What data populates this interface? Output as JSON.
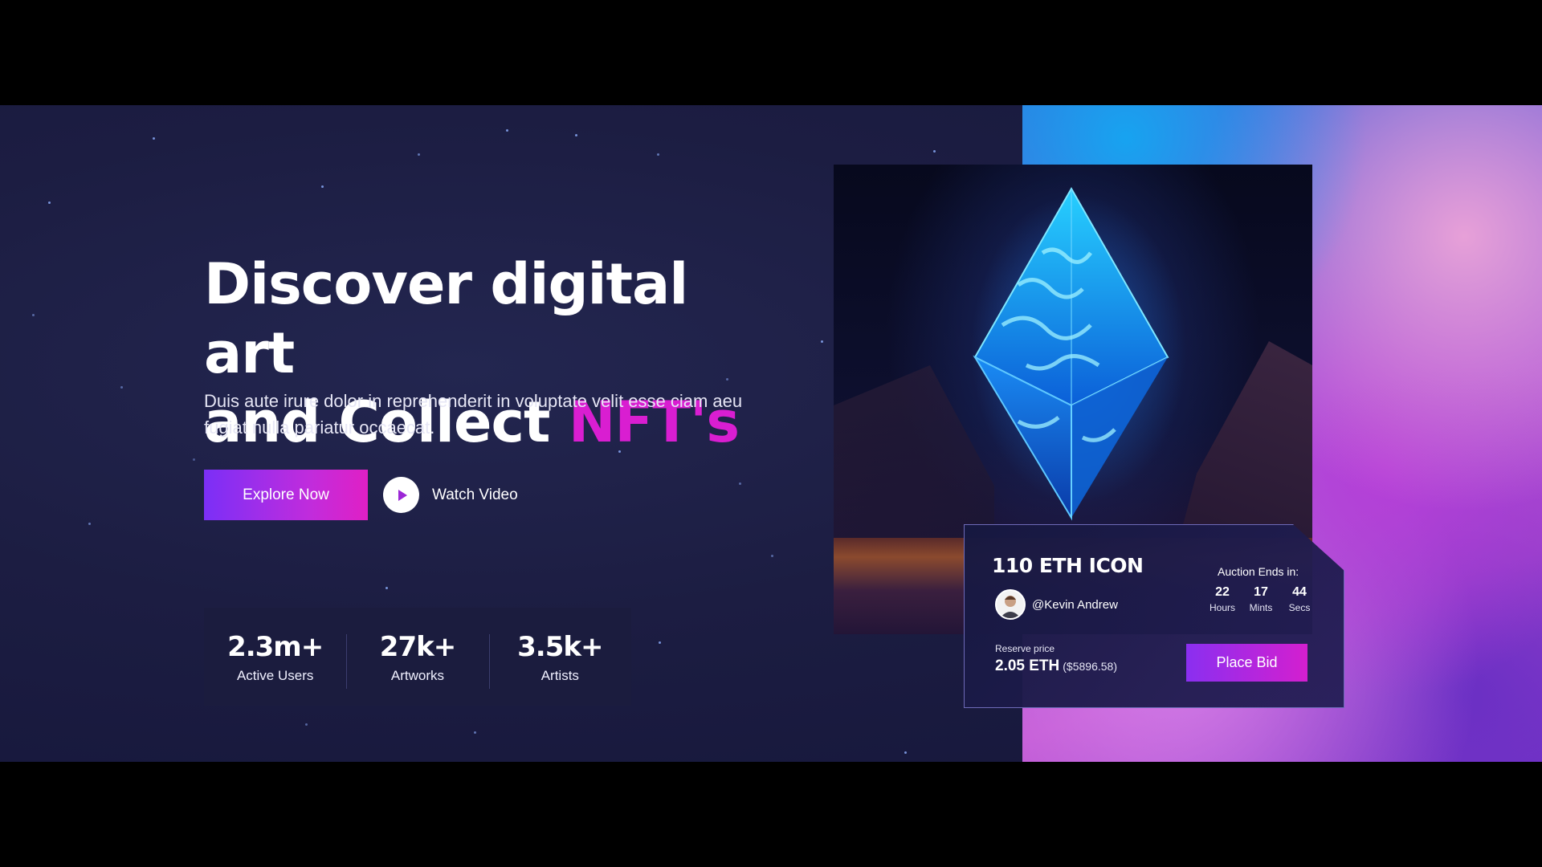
{
  "hero": {
    "headline_line1": "Discover digital art",
    "headline_line2_prefix": "and Collect ",
    "headline_line2_accent": "NFT's",
    "subtitle": "Duis aute irure dolor in reprehenderit in voluptate velit esse ciam aeu fugiat nulla pariatur occaecat.",
    "explore_label": "Explore Now",
    "watch_label": "Watch Video"
  },
  "stats": [
    {
      "value": "2.3m+",
      "label": "Active Users"
    },
    {
      "value": "27k+",
      "label": "Artworks"
    },
    {
      "value": "3.5k+",
      "label": "Artists"
    }
  ],
  "auction": {
    "title": "110 ETH ICON",
    "creator": "@Kevin Andrew",
    "ends_label": "Auction Ends in:",
    "countdown": [
      {
        "value": "22",
        "unit": "Hours"
      },
      {
        "value": "17",
        "unit": "Mints"
      },
      {
        "value": "44",
        "unit": "Secs"
      }
    ],
    "reserve_label": "Reserve price",
    "reserve_value": "2.05 ETH",
    "reserve_usd": "($5896.58)",
    "bid_label": "Place Bid"
  },
  "colors": {
    "accent_magenta": "#d91ed1",
    "button_gradient_start": "#7b2ff7",
    "button_gradient_end": "#e020c5",
    "background": "#1c1d42",
    "eth_glow": "#1e8cff"
  },
  "icons": {
    "play": "play-icon",
    "eth": "ethereum-icon"
  }
}
